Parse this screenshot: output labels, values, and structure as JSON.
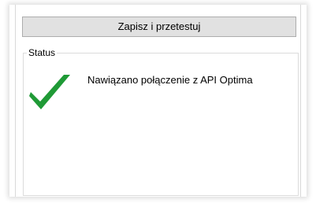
{
  "toolbar": {
    "save_test_label": "Zapisz i przetestuj"
  },
  "status": {
    "group_title": "Status",
    "icon": "checkmark-icon",
    "icon_color": "#1f9a36",
    "message": "Nawiązano połączenie z API Optima"
  }
}
